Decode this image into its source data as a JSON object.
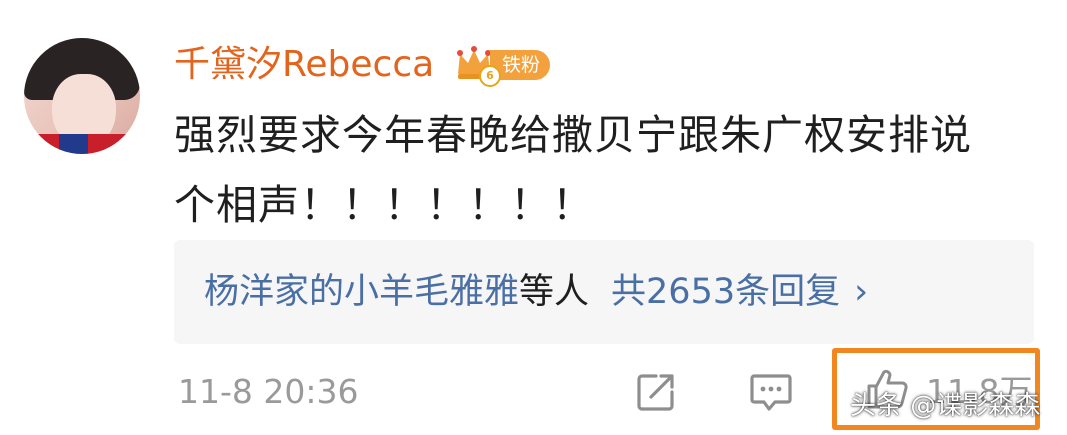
{
  "post": {
    "username": "千黛汐Rebecca",
    "badge": {
      "level": "6",
      "label": "铁粉"
    },
    "comment_lines": [
      "强烈要求今年春晚给撒贝宁跟朱广权安排说",
      "个相声！！！！！！！"
    ],
    "replies": {
      "users": "杨洋家的小羊毛雅雅",
      "suffix": "等人",
      "count_text": "共2653条回复",
      "chevron": "›"
    },
    "timestamp": "11-8 20:36",
    "actions": {
      "share_icon": "share-icon",
      "comment_icon": "comment-icon",
      "like_icon": "thumbs-up-icon",
      "like_count": "11.8万"
    }
  },
  "watermark": "头条 @谍影森森",
  "colors": {
    "username": "#e3641d",
    "link": "#4a6fa5",
    "meta": "#9a9a9a",
    "highlight": "#f3871f",
    "badge": "#f2a13c"
  }
}
